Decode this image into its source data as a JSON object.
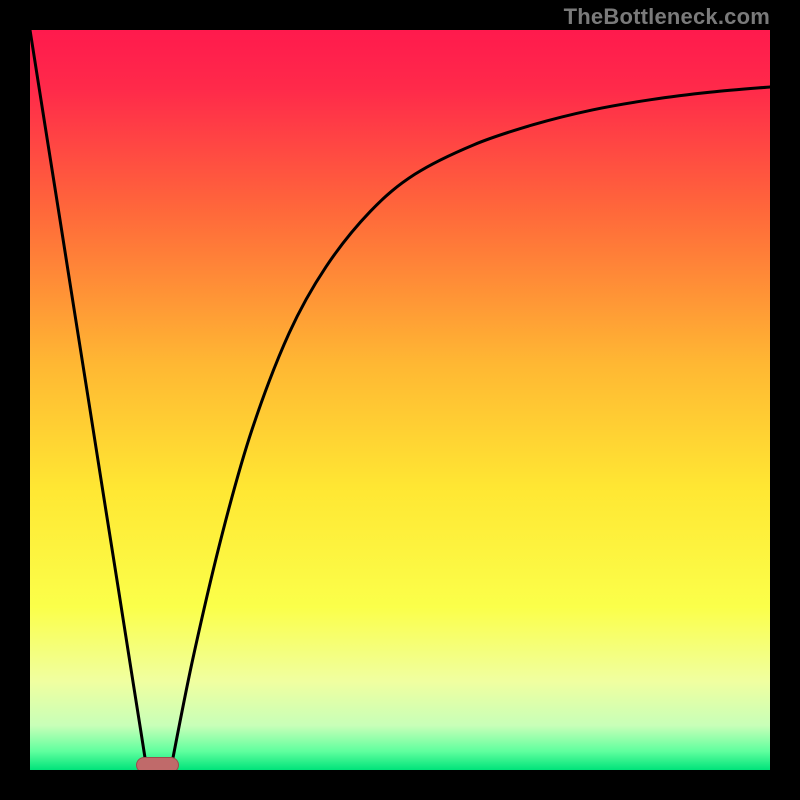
{
  "watermark": "TheBottleneck.com",
  "chart_data": {
    "type": "line",
    "title": "",
    "xlabel": "",
    "ylabel": "",
    "xlim": [
      0,
      100
    ],
    "ylim": [
      0,
      100
    ],
    "gradient_stops": [
      {
        "pos": 0.0,
        "color": "#ff1a4d"
      },
      {
        "pos": 0.08,
        "color": "#ff2a4a"
      },
      {
        "pos": 0.25,
        "color": "#ff6a3a"
      },
      {
        "pos": 0.45,
        "color": "#ffb733"
      },
      {
        "pos": 0.62,
        "color": "#ffe733"
      },
      {
        "pos": 0.78,
        "color": "#fbff4a"
      },
      {
        "pos": 0.88,
        "color": "#f0ffa0"
      },
      {
        "pos": 0.94,
        "color": "#c8ffb8"
      },
      {
        "pos": 0.975,
        "color": "#5fff9e"
      },
      {
        "pos": 1.0,
        "color": "#00e37a"
      }
    ],
    "series": [
      {
        "name": "left-branch",
        "x": [
          0.0,
          2.0,
          4.0,
          6.0,
          8.0,
          10.0,
          12.0,
          14.0,
          15.0,
          15.8
        ],
        "y": [
          100.0,
          87.3,
          74.7,
          62.0,
          49.4,
          36.7,
          24.1,
          11.4,
          5.1,
          0.0
        ]
      },
      {
        "name": "right-branch",
        "x": [
          19.0,
          22.0,
          26.0,
          30.0,
          35.0,
          40.0,
          46.0,
          52.0,
          60.0,
          68.0,
          76.0,
          84.0,
          92.0,
          100.0
        ],
        "y": [
          0.0,
          15.0,
          32.0,
          46.0,
          59.0,
          68.0,
          75.5,
          80.5,
          84.5,
          87.2,
          89.2,
          90.6,
          91.6,
          92.3
        ]
      }
    ],
    "marker": {
      "name": "optimal-region",
      "x_start": 14.3,
      "x_end": 19.8,
      "y": 0.5
    }
  }
}
